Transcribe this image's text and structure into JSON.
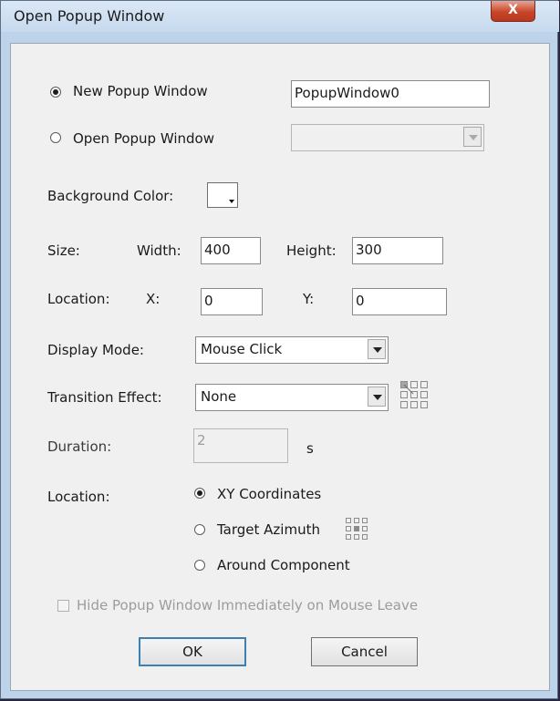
{
  "window": {
    "title": "Open Popup Window",
    "close_glyph": "X"
  },
  "popup_choice": {
    "new_label": "New Popup Window",
    "new_selected": true,
    "new_name_value": "PopupWindow0",
    "open_label": "Open Popup Window",
    "open_selected": false,
    "open_select_value": ""
  },
  "background_color": {
    "label": "Background Color:",
    "swatch": "#ffffff"
  },
  "size": {
    "label": "Size:",
    "width_label": "Width:",
    "width_value": "400",
    "height_label": "Height:",
    "height_value": "300"
  },
  "location_xy": {
    "label": "Location:",
    "x_label": "X:",
    "x_value": "0",
    "y_label": "Y:",
    "y_value": "0"
  },
  "display_mode": {
    "label": "Display Mode:",
    "value": "Mouse Click"
  },
  "transition": {
    "label": "Transition Effect:",
    "value": "None",
    "icon": "direction-grid-icon"
  },
  "duration": {
    "label": "Duration:",
    "value": "2",
    "unit": "s"
  },
  "location_mode": {
    "label": "Location:",
    "options": [
      {
        "label": "XY Coordinates",
        "selected": true
      },
      {
        "label": "Target Azimuth",
        "selected": false
      },
      {
        "label": "Around Component",
        "selected": false
      }
    ],
    "azimuth_icon": "azimuth-grid-icon"
  },
  "hide_on_leave": {
    "label": "Hide Popup Window Immediately on Mouse Leave",
    "checked": false,
    "enabled": false
  },
  "buttons": {
    "ok": "OK",
    "cancel": "Cancel"
  }
}
